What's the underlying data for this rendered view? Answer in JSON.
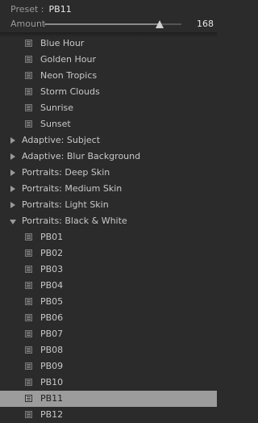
{
  "header": {
    "preset_label": "Preset :",
    "preset_value": "PB11",
    "amount_label": "Amount",
    "amount_value": "168",
    "amount_fraction": 0.84
  },
  "list": {
    "items": [
      {
        "type": "child",
        "label": "Blue Hour"
      },
      {
        "type": "child",
        "label": "Golden Hour"
      },
      {
        "type": "child",
        "label": "Neon Tropics"
      },
      {
        "type": "child",
        "label": "Storm Clouds"
      },
      {
        "type": "child",
        "label": "Sunrise"
      },
      {
        "type": "child",
        "label": "Sunset"
      },
      {
        "type": "group",
        "label": "Adaptive: Subject",
        "open": false
      },
      {
        "type": "group",
        "label": "Adaptive: Blur Background",
        "open": false
      },
      {
        "type": "group",
        "label": "Portraits: Deep Skin",
        "open": false
      },
      {
        "type": "group",
        "label": "Portraits: Medium Skin",
        "open": false
      },
      {
        "type": "group",
        "label": "Portraits: Light Skin",
        "open": false
      },
      {
        "type": "group",
        "label": "Portraits: Black & White",
        "open": true
      },
      {
        "type": "child",
        "label": "PB01"
      },
      {
        "type": "child",
        "label": "PB02"
      },
      {
        "type": "child",
        "label": "PB03"
      },
      {
        "type": "child",
        "label": "PB04"
      },
      {
        "type": "child",
        "label": "PB05"
      },
      {
        "type": "child",
        "label": "PB06"
      },
      {
        "type": "child",
        "label": "PB07"
      },
      {
        "type": "child",
        "label": "PB08"
      },
      {
        "type": "child",
        "label": "PB09"
      },
      {
        "type": "child",
        "label": "PB10"
      },
      {
        "type": "child",
        "label": "PB11",
        "selected": true
      },
      {
        "type": "child",
        "label": "PB12"
      }
    ]
  }
}
